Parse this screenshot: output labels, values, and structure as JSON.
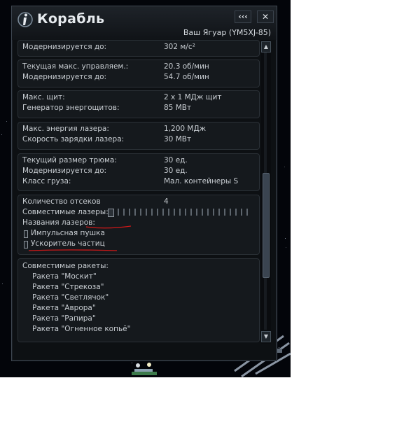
{
  "window": {
    "title": "Корабль",
    "collapse_label": "‹‹‹",
    "close_label": "✕",
    "subtitle": "Ваш Ягуар (YM5XJ-85)"
  },
  "icons": {
    "info": "info-icon",
    "collapse": "collapse-icon",
    "close": "close-icon",
    "scroll_up": "scroll-up-icon",
    "scroll_down": "scroll-down-icon"
  },
  "sections": {
    "speed": {
      "upgrade_label": "Модернизируется до:",
      "upgrade_value": "302 м/с²"
    },
    "steering": {
      "current_label": "Текущая макс. управляем.:",
      "current_value": "20.3 об/мин",
      "upgrade_label": "Модернизируется до:",
      "upgrade_value": "54.7 об/мин"
    },
    "shield": {
      "max_label": "Макс. щит:",
      "max_value": "2 x 1 МДж щит",
      "generator_label": "Генератор энергощитов:",
      "generator_value": "85 МВт"
    },
    "laser": {
      "energy_label": "Макс. энергия лазера:",
      "energy_value": "1,200 МДж",
      "charge_label": "Скорость зарядки лазера:",
      "charge_value": "30 МВт"
    },
    "cargo": {
      "size_label": "Текущий размер трюма:",
      "size_value": "30 ед.",
      "upgrade_label": "Модернизируется до:",
      "upgrade_value": "30 ед.",
      "class_label": "Класс груза:",
      "class_value": "Мал. контейнеры S"
    },
    "weapons": {
      "bays_label": "Количество отсеков",
      "bays_value": "4",
      "compatible_label": "Совместимые лазеры:",
      "names_label": "Названия лазеров:",
      "lasers": [
        "Импульсная пушка",
        "Ускоритель частиц"
      ]
    },
    "missiles": {
      "label": "Совместимые ракеты:",
      "items": [
        "Ракета \"Москит\"",
        "Ракета \"Стрекоза\"",
        "Ракета \"Светлячок\"",
        "Ракета \"Аврора\"",
        "Ракета \"Рапира\"",
        "Ракета \"Огненное копьё\""
      ]
    }
  },
  "colors": {
    "annotation_underline": "#d01818",
    "panel_bg": "#0d1013",
    "section_bg": "#15191d"
  }
}
